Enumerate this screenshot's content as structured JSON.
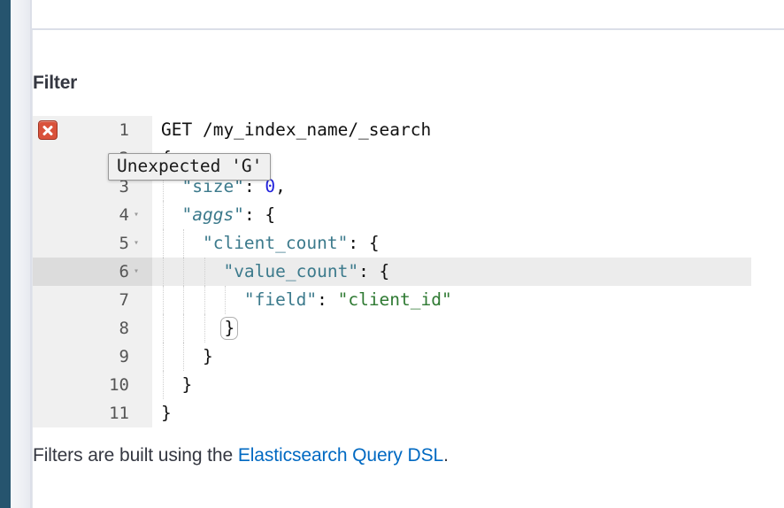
{
  "theme": {
    "rail_color": "#26546e",
    "accent_link": "#0069c2",
    "error_color": "#d9523b",
    "gutter_bg": "#f0f0f0",
    "active_line_bg": "#ececec",
    "key_color": "#3c7a8c",
    "string_color": "#2f7a33",
    "number_color": "#2222dd"
  },
  "panel": {
    "title": "Filter"
  },
  "editor": {
    "language": "json",
    "active_line": 6,
    "error_line": 1,
    "error_icon": "error-cross-icon",
    "fold_glyph": "▾",
    "lines": [
      {
        "number": "1",
        "foldable": false,
        "has_error": true,
        "indent": 0,
        "tokens": [
          {
            "t": "GET /my_index_name/_search",
            "c": "p"
          }
        ]
      },
      {
        "number": "2",
        "foldable": true,
        "has_error": false,
        "indent": 0,
        "tokens": [
          {
            "t": "{",
            "c": "p"
          }
        ]
      },
      {
        "number": "3",
        "foldable": false,
        "has_error": false,
        "indent": 1,
        "tokens": [
          {
            "t": "  ",
            "c": "p"
          },
          {
            "t": "\"size\"",
            "c": "k"
          },
          {
            "t": ": ",
            "c": "p"
          },
          {
            "t": "0",
            "c": "num"
          },
          {
            "t": ",",
            "c": "p"
          }
        ]
      },
      {
        "number": "4",
        "foldable": true,
        "has_error": false,
        "indent": 1,
        "tokens": [
          {
            "t": "  ",
            "c": "p"
          },
          {
            "t": "\"aggs\"",
            "c": "ki"
          },
          {
            "t": ": {",
            "c": "p"
          }
        ]
      },
      {
        "number": "5",
        "foldable": true,
        "has_error": false,
        "indent": 2,
        "tokens": [
          {
            "t": "    ",
            "c": "p"
          },
          {
            "t": "\"client_count\"",
            "c": "k"
          },
          {
            "t": ": {",
            "c": "p"
          }
        ]
      },
      {
        "number": "6",
        "foldable": true,
        "has_error": false,
        "indent": 3,
        "tokens": [
          {
            "t": "      ",
            "c": "p"
          },
          {
            "t": "\"value_count\"",
            "c": "k"
          },
          {
            "t": ": {",
            "c": "p"
          }
        ]
      },
      {
        "number": "7",
        "foldable": false,
        "has_error": false,
        "indent": 4,
        "tokens": [
          {
            "t": "        ",
            "c": "p"
          },
          {
            "t": "\"field\"",
            "c": "k"
          },
          {
            "t": ": ",
            "c": "p"
          },
          {
            "t": "\"client_id\"",
            "c": "s"
          }
        ]
      },
      {
        "number": "8",
        "foldable": false,
        "has_error": false,
        "indent": 3,
        "brace_match": true,
        "tokens": [
          {
            "t": "      ",
            "c": "p"
          },
          {
            "t": "}",
            "c": "p"
          }
        ]
      },
      {
        "number": "9",
        "foldable": false,
        "has_error": false,
        "indent": 2,
        "tokens": [
          {
            "t": "    ",
            "c": "p"
          },
          {
            "t": "}",
            "c": "p"
          }
        ]
      },
      {
        "number": "10",
        "foldable": false,
        "has_error": false,
        "indent": 1,
        "tokens": [
          {
            "t": "  ",
            "c": "p"
          },
          {
            "t": "}",
            "c": "p"
          }
        ]
      },
      {
        "number": "11",
        "foldable": false,
        "has_error": false,
        "indent": 0,
        "tokens": [
          {
            "t": "}",
            "c": "p"
          }
        ]
      }
    ]
  },
  "tooltip": {
    "text": "Unexpected 'G'"
  },
  "help": {
    "prefix": "Filters are built using the ",
    "link_text": "Elasticsearch Query DSL",
    "suffix": "."
  }
}
